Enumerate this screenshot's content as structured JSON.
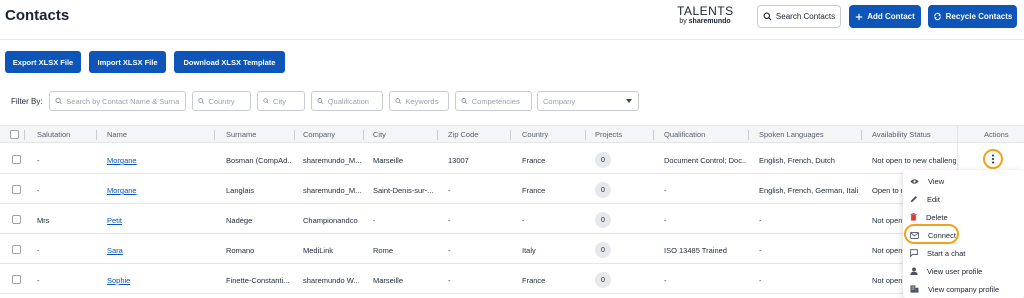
{
  "header": {
    "title": "Contacts",
    "logo_top": "TALENTS",
    "logo_by": "by ",
    "logo_brand": "sharemundo",
    "search_label": "Search Contacts",
    "add_label": "Add Contact",
    "recycle_label": "Recycle Contacts"
  },
  "toolbar": {
    "export_label": "Export XLSX File",
    "import_label": "Import XLSX File",
    "template_label": "Download XLSX Template"
  },
  "filters": {
    "label": "Filter By:",
    "search_placeholder": "Search by Contact Name & Surna",
    "country_placeholder": "Country",
    "city_placeholder": "City",
    "qualification_placeholder": "Qualification",
    "keywords_placeholder": "Keywords",
    "competencies_placeholder": "Competencies",
    "company_placeholder": "Company"
  },
  "table": {
    "columns": [
      "Salutation",
      "Name",
      "Surname",
      "Company",
      "City",
      "Zip Code",
      "Country",
      "Projects",
      "Qualification",
      "Spoken Languages",
      "Availability Status",
      "Actions"
    ],
    "rows": [
      {
        "salutation": "-",
        "name": "Morgane",
        "surname": "Bosman (CompAd...",
        "company": "sharemundo_M...",
        "city": "Marseille",
        "zip": "13007",
        "country": "France",
        "projects": "0",
        "qualification": "Document Control; Doc...",
        "languages": "English, French, Dutch",
        "availability": "Not open to new challenges"
      },
      {
        "salutation": "-",
        "name": "Morgane",
        "surname": "Langlais",
        "company": "sharemundo_M...",
        "city": "Saint-Denis-sur-...",
        "zip": "-",
        "country": "France",
        "projects": "0",
        "qualification": "-",
        "languages": "English, French, German, Itali...",
        "availability": "Open to n"
      },
      {
        "salutation": "Mrs",
        "name": "Petit",
        "surname": "Nadège",
        "company": "Championandco",
        "city": "-",
        "zip": "-",
        "country": "-",
        "projects": "0",
        "qualification": "-",
        "languages": "-",
        "availability": "Not open"
      },
      {
        "salutation": "-",
        "name": "Sara",
        "surname": "Romano",
        "company": "MediLink",
        "city": "Rome",
        "zip": "-",
        "country": "Italy",
        "projects": "0",
        "qualification": "ISO 13485 Trained",
        "languages": "-",
        "availability": "Not open"
      },
      {
        "salutation": "-",
        "name": "Sophie",
        "surname": "Finette-Constanti...",
        "company": "sharemundo W...",
        "city": "Marseille",
        "zip": "-",
        "country": "France",
        "projects": "0",
        "qualification": "-",
        "languages": "-",
        "availability": "Not open"
      }
    ]
  },
  "actions_menu": {
    "items": [
      {
        "label": "View",
        "icon": "eye-icon"
      },
      {
        "label": "Edit",
        "icon": "pencil-icon"
      },
      {
        "label": "Delete",
        "icon": "trash-icon"
      },
      {
        "label": "Connect",
        "icon": "mail-icon"
      },
      {
        "label": "Start a chat",
        "icon": "chat-icon"
      },
      {
        "label": "View user profile",
        "icon": "user-icon"
      },
      {
        "label": "View company profile",
        "icon": "building-icon"
      }
    ]
  },
  "colors": {
    "primary": "#0d55b8",
    "highlight": "#f3a31b",
    "delete": "#d93a3a"
  }
}
